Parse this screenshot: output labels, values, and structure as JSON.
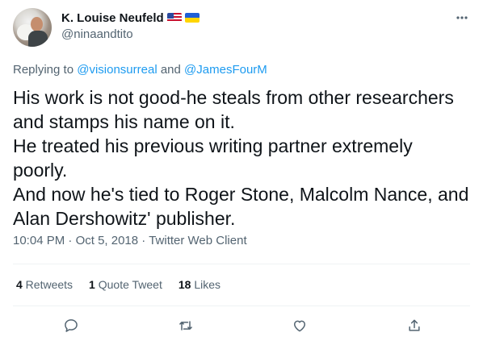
{
  "tweet": {
    "author": {
      "display_name": "K. Louise Neufeld",
      "handle": "@ninaandtito",
      "flags": [
        "us-flag-icon",
        "ukraine-flag-icon"
      ]
    },
    "reply": {
      "prefix": "Replying to ",
      "mention1": "@visionsurreal",
      "joiner": " and ",
      "mention2": "@JamesFourM"
    },
    "text_lines": [
      "His work is not good-he steals from other researchers",
      "and stamps his name on it.",
      "He treated his previous writing partner extremely",
      "poorly.",
      "And now he's tied to Roger Stone, Malcolm Nance, and",
      "Alan Dershowitz' publisher."
    ],
    "time": "10:04 PM",
    "sep": " · ",
    "date": "Oct 5, 2018",
    "source": "Twitter Web Client"
  },
  "stats": {
    "retweets_count": "4",
    "retweets_label": " Retweets",
    "quote_count": "1",
    "quote_label": " Quote Tweet",
    "likes_count": "18",
    "likes_label": " Likes"
  },
  "actions": [
    "reply-icon",
    "retweet-icon",
    "like-icon",
    "share-icon"
  ],
  "colors": {
    "accent": "#1d9bf0",
    "muted": "#536471",
    "text": "#0f1419",
    "divider": "#eff3f4"
  }
}
